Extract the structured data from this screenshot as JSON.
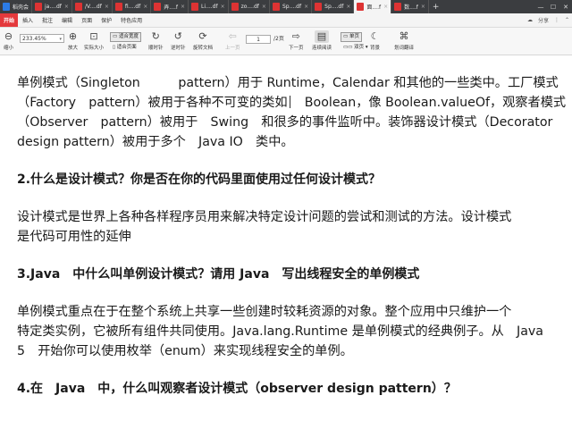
{
  "tabs": [
    {
      "label": "稻壳会",
      "active": false,
      "kind": "home"
    },
    {
      "label": "ja....df",
      "active": false
    },
    {
      "label": "/V....df",
      "active": false
    },
    {
      "label": "fi....df",
      "active": false
    },
    {
      "label": "弄....f",
      "active": false
    },
    {
      "label": "Li....df",
      "active": false
    },
    {
      "label": "zo....df",
      "active": false
    },
    {
      "label": "Sp....df",
      "active": false
    },
    {
      "label": "Sp....df",
      "active": false
    },
    {
      "label": "面....f",
      "active": true
    },
    {
      "label": "数....f",
      "active": false
    }
  ],
  "menu": {
    "start": "开始",
    "items": [
      "插入",
      "批注",
      "编辑",
      "页面",
      "保护",
      "特色应用"
    ],
    "right": [
      "分享"
    ]
  },
  "toolbar": {
    "zoom": "233.45%",
    "shrink": "缩小",
    "enlarge": "放大",
    "actual_size": "实际大小",
    "fit_width": "适合宽度",
    "fit_page": "适合页面",
    "rotate_left": "顺时针",
    "rotate_right": "逆时针",
    "rotate_doc": "旋转文档",
    "prev_page": "上一页",
    "next_page": "下一页",
    "page_current": "1",
    "page_total": "/2页",
    "continuous": "连续阅读",
    "single": "单页",
    "double": "双页",
    "background": "背景",
    "translate": "划词翻译"
  },
  "document": {
    "para1": [
      "单例模式（Singleton　　　pattern）用于 Runtime，Calendar 和其他的一些类中。工厂模式",
      "（Factory　pattern）被用于各种不可变的类如",
      "　Boolean，像 Boolean.valueOf，观察者模式",
      "（Observer　pattern）被用于　Swing　和很多的事件监听中。装饰器设计模式（Decorator",
      "design pattern）被用于多个　Java IO　类中。"
    ],
    "h2": "2.什么是设计模式？你是否在你的代码里面使用过任何设计模式？",
    "para2": [
      "设计模式是世界上各种各样程序员用来解决特定设计问题的尝试和测试的方法。设计模式",
      "是代码可用性的延伸"
    ],
    "h3": "3.Java　中什么叫单例设计模式？请用 Java　写出线程安全的单例模式",
    "para3": [
      "单例模式重点在于在整个系统上共享一些创建时较耗资源的对象。整个应用中只维护一个",
      "特定类实例，它被所有组件共同使用。Java.lang.Runtime 是单例模式的经典例子。从　Java",
      "5　开始你可以使用枚举（enum）来实现线程安全的单例。"
    ],
    "h4": "4.在　Java　中，什么叫观察者设计模式（observer design pattern）？"
  },
  "colors": {
    "accent": "#2c7be5",
    "start_button": "#e4393c",
    "tabbar": "#3b3d40"
  }
}
